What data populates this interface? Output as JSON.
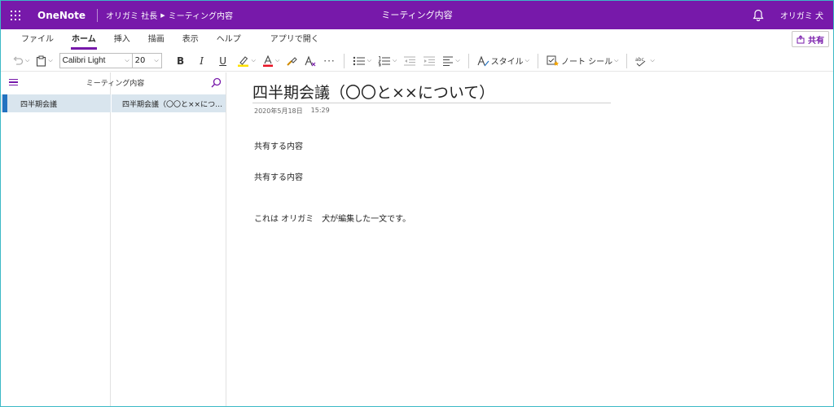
{
  "titlebar": {
    "app_name": "OneNote",
    "breadcrumb": [
      "オリガミ 社長",
      "ミーティング内容"
    ],
    "window_title": "ミーティング内容",
    "user_name": "オリガミ 犬"
  },
  "ribbon": {
    "tabs": [
      "ファイル",
      "ホーム",
      "挿入",
      "描画",
      "表示",
      "ヘルプ",
      "アプリで開く"
    ],
    "active_tab": "ホーム",
    "share_label": "共有"
  },
  "toolbar": {
    "font_name": "Calibri Light",
    "font_size": "20",
    "bold": "B",
    "italic": "I",
    "underline": "U",
    "more": "···",
    "styles_label": "スタイル",
    "tags_label": "ノート シール",
    "font_color": "#e81123",
    "highlight_color": "#ffe100"
  },
  "notebook": {
    "title": "ミーティング内容",
    "sections": [
      "四半期会議"
    ],
    "pages": [
      "四半期会議（〇〇と××につ…"
    ]
  },
  "page": {
    "title": "四半期会議（〇〇と××について）",
    "date": "2020年5月18日",
    "time": "15:29",
    "paragraphs": [
      "共有する内容",
      "共有する内容",
      "これは オリガミ　犬が編集した一文です。"
    ]
  },
  "colors": {
    "accent": "#7719aa",
    "selection": "#d9e5ee",
    "section_marker": "#2372c0"
  }
}
